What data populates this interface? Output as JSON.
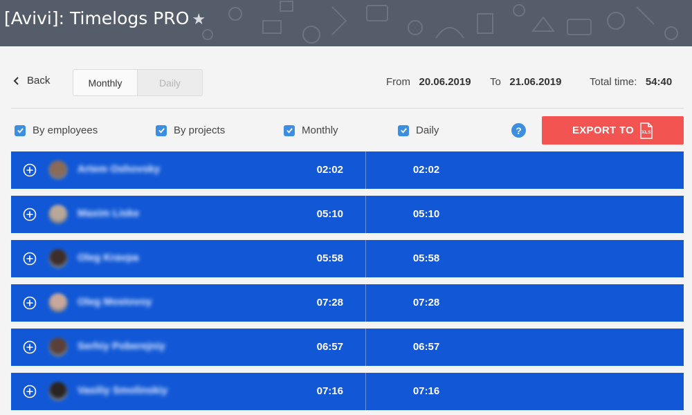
{
  "header": {
    "title": "[Avivi]: Timelogs PRO",
    "star_icon": "star-icon"
  },
  "toolbar": {
    "back_label": "Back",
    "view_toggle": {
      "options": [
        "Monthly",
        "Daily"
      ],
      "selected": "Monthly"
    },
    "from_label": "From",
    "from_value": "20.06.2019",
    "to_label": "To",
    "to_value": "21.06.2019",
    "total_label": "Total time:",
    "total_value": "54:40"
  },
  "filters": {
    "by_employees": {
      "label": "By employees",
      "checked": true
    },
    "by_projects": {
      "label": "By projects",
      "checked": true
    },
    "monthly": {
      "label": "Monthly",
      "checked": true
    },
    "daily": {
      "label": "Daily",
      "checked": true
    },
    "help_label": "?",
    "export_label": "EXPORT TO",
    "export_icon": "xls-file-icon"
  },
  "rows": [
    {
      "name": "Artem Oshovsky",
      "total": "02:02",
      "daily": "02:02",
      "avatar_color": "#8a6a58"
    },
    {
      "name": "Maxim Liske",
      "total": "05:10",
      "daily": "05:10",
      "avatar_color": "#b9a89a"
    },
    {
      "name": "Oleg Kravpa",
      "total": "05:58",
      "daily": "05:58",
      "avatar_color": "#3d2e2a"
    },
    {
      "name": "Oleg Mostovoy",
      "total": "07:28",
      "daily": "07:28",
      "avatar_color": "#c8a89a"
    },
    {
      "name": "Serhiy Poberejniy",
      "total": "06:57",
      "daily": "06:57",
      "avatar_color": "#5a4038"
    },
    {
      "name": "Vasiliy Smolinskiy",
      "total": "07:16",
      "daily": "07:16",
      "avatar_color": "#2a2422"
    }
  ],
  "colors": {
    "row_bg": "#1258d6",
    "export_bg": "#f25551",
    "accent": "#3c8fe0",
    "topbar": "#555d6a"
  }
}
